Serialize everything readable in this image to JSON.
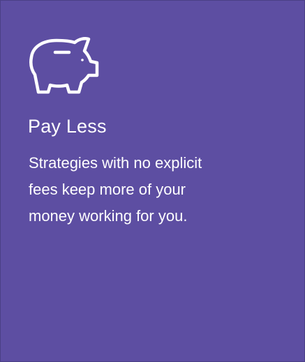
{
  "card": {
    "icon": "piggy-bank-icon",
    "title": "Pay Less",
    "description_lines": [
      "Strategies with no explicit",
      "fees keep more of your",
      "money working for you."
    ]
  },
  "colors": {
    "background": "#5d4ea2",
    "text": "#ffffff"
  }
}
